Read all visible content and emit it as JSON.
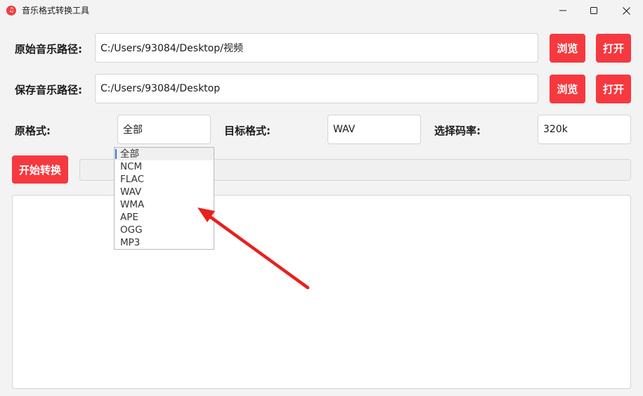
{
  "window": {
    "title": "音乐格式转换工具",
    "app_icon_glyph": "♫"
  },
  "source_path": {
    "label": "原始音乐路径:",
    "value": "C:/Users/93084/Desktop/视频",
    "browse_label": "浏览",
    "open_label": "打开"
  },
  "save_path": {
    "label": "保存音乐路径:",
    "value": "C:/Users/93084/Desktop",
    "browse_label": "浏览",
    "open_label": "打开"
  },
  "format_row": {
    "source_format_label": "原格式:",
    "source_format_value": "全部",
    "target_format_label": "目标格式:",
    "target_format_value": "WAV",
    "bitrate_label": "选择码率:",
    "bitrate_value": "320k"
  },
  "source_format_options": [
    "全部",
    "NCM",
    "FLAC",
    "WAV",
    "WMA",
    "APE",
    "OGG",
    "MP3"
  ],
  "source_format_selected_index": 0,
  "actions": {
    "start_label": "开始转换"
  },
  "progress": {
    "value": 0
  },
  "log": {
    "text": ""
  },
  "colors": {
    "accent_red": "#f5393f",
    "annotation_arrow": "#e8211c",
    "background": "#f3f3f3"
  }
}
